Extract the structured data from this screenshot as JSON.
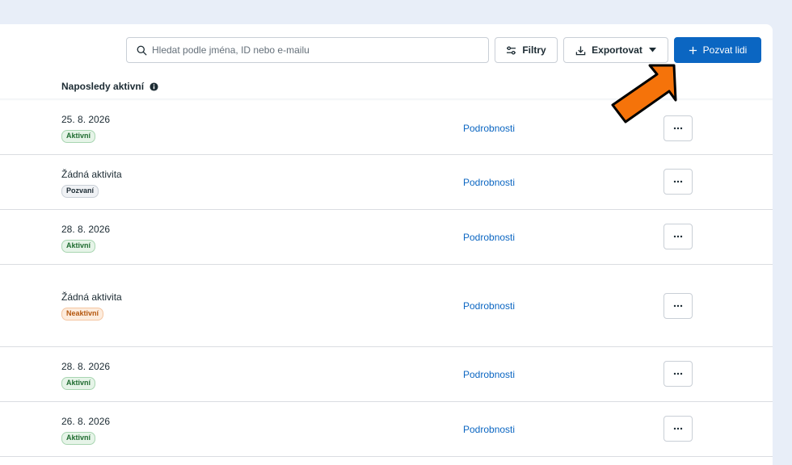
{
  "toolbar": {
    "search_placeholder": "Hledat podle jména, ID nebo e-mailu",
    "filter_label": "Filtry",
    "export_label": "Exportovat",
    "invite_label": "Pozvat lidi"
  },
  "table": {
    "column_header": "Naposledy aktivní",
    "details_label": "Podrobnosti",
    "rows": [
      {
        "date": "25. 8. 2026",
        "status": "Aktivní",
        "status_color": "green"
      },
      {
        "date": "Žádná aktivita",
        "status": "Pozvaní",
        "status_color": "gray"
      },
      {
        "date": "28. 8. 2026",
        "status": "Aktivní",
        "status_color": "green"
      },
      {
        "date": "Žádná aktivita",
        "status": "Neaktivní",
        "status_color": "orange"
      },
      {
        "date": "28. 8. 2026",
        "status": "Aktivní",
        "status_color": "green"
      },
      {
        "date": "26. 8. 2026",
        "status": "Aktivní",
        "status_color": "green"
      }
    ]
  },
  "colors": {
    "accent": "#0b66c2",
    "annotation_arrow": "#f5730a",
    "background": "#e8eef8"
  },
  "icons": {
    "search": "search-icon",
    "filter": "filter-sliders-icon",
    "export": "download-icon",
    "export_caret": "caret-down-icon",
    "invite": "plus-icon",
    "info": "info-icon",
    "more": "ellipsis-icon",
    "annotation": "arrow-pointer-icon"
  }
}
